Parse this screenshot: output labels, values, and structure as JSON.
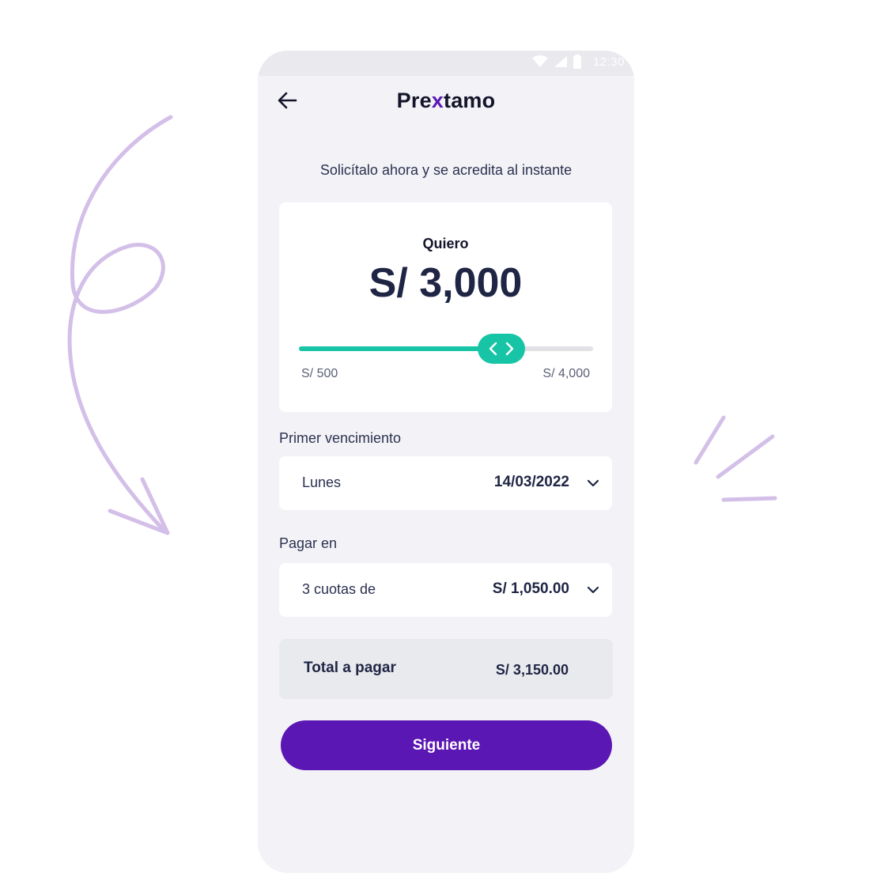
{
  "status": {
    "time": "12:30"
  },
  "header": {
    "logo_pre": "Pre",
    "logo_x": "x",
    "logo_post": "tamo"
  },
  "subtitle": "Solicítalo ahora y se acredita al instante",
  "loan_card": {
    "want_label": "Quiero",
    "amount": "S/ 3,000",
    "slider": {
      "min_label": "S/ 500",
      "max_label": "S/ 4,000",
      "min": 500,
      "max": 4000,
      "value": 3000,
      "fill_fraction": 0.687
    }
  },
  "due_date": {
    "label": "Primer vencimiento",
    "day": "Lunes",
    "date": "14/03/2022"
  },
  "payment": {
    "label": "Pagar en",
    "installments": "3 cuotas de",
    "amount": "S/ 1,050.00"
  },
  "total": {
    "label": "Total a pagar",
    "value": "S/ 3,150.00"
  },
  "next_button": "Siguiente",
  "colors": {
    "accent": "#5b17b3",
    "slider": "#17c5a6",
    "decoration": "#d3bfe8",
    "background": "#f3f3f7"
  },
  "icons": [
    "wifi-icon",
    "signal-icon",
    "battery-icon",
    "back-arrow-icon",
    "chevron-left-icon",
    "chevron-right-icon",
    "chevron-down-icon"
  ]
}
